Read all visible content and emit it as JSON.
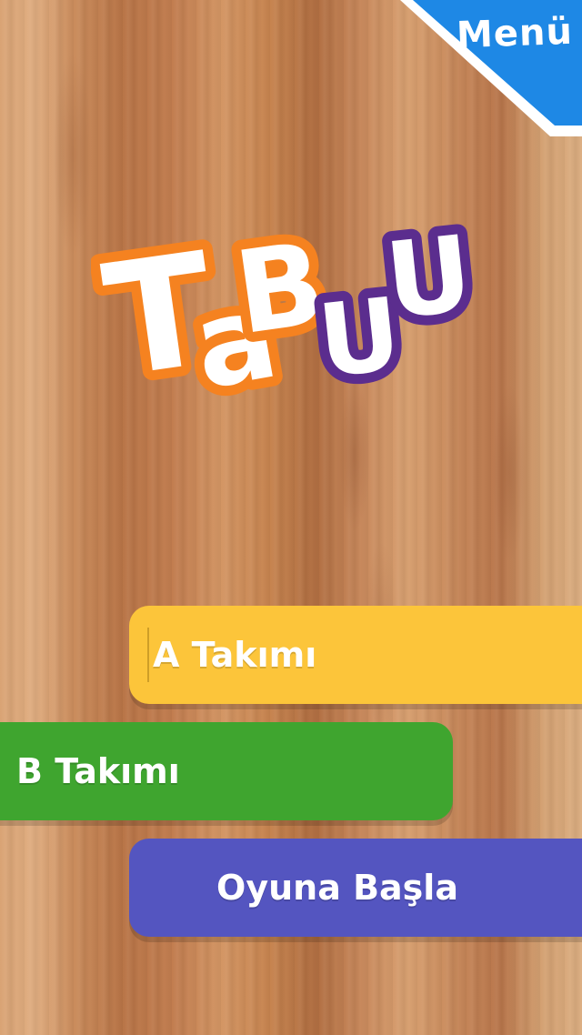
{
  "menu": {
    "label": "Menü",
    "color": "#1e88e5"
  },
  "logo": {
    "letters": [
      "T",
      "a",
      "B",
      "U",
      "U"
    ],
    "colors": {
      "orange": "#f58220",
      "purple": "#5b2d8e",
      "fill": "#ffffff"
    }
  },
  "team_a": {
    "label": "A Takımı",
    "color": "#fcc53a"
  },
  "team_b": {
    "label": "B Takımı",
    "color": "#3fa52f"
  },
  "start": {
    "label": "Oyuna Başla",
    "color": "#5455c0"
  }
}
